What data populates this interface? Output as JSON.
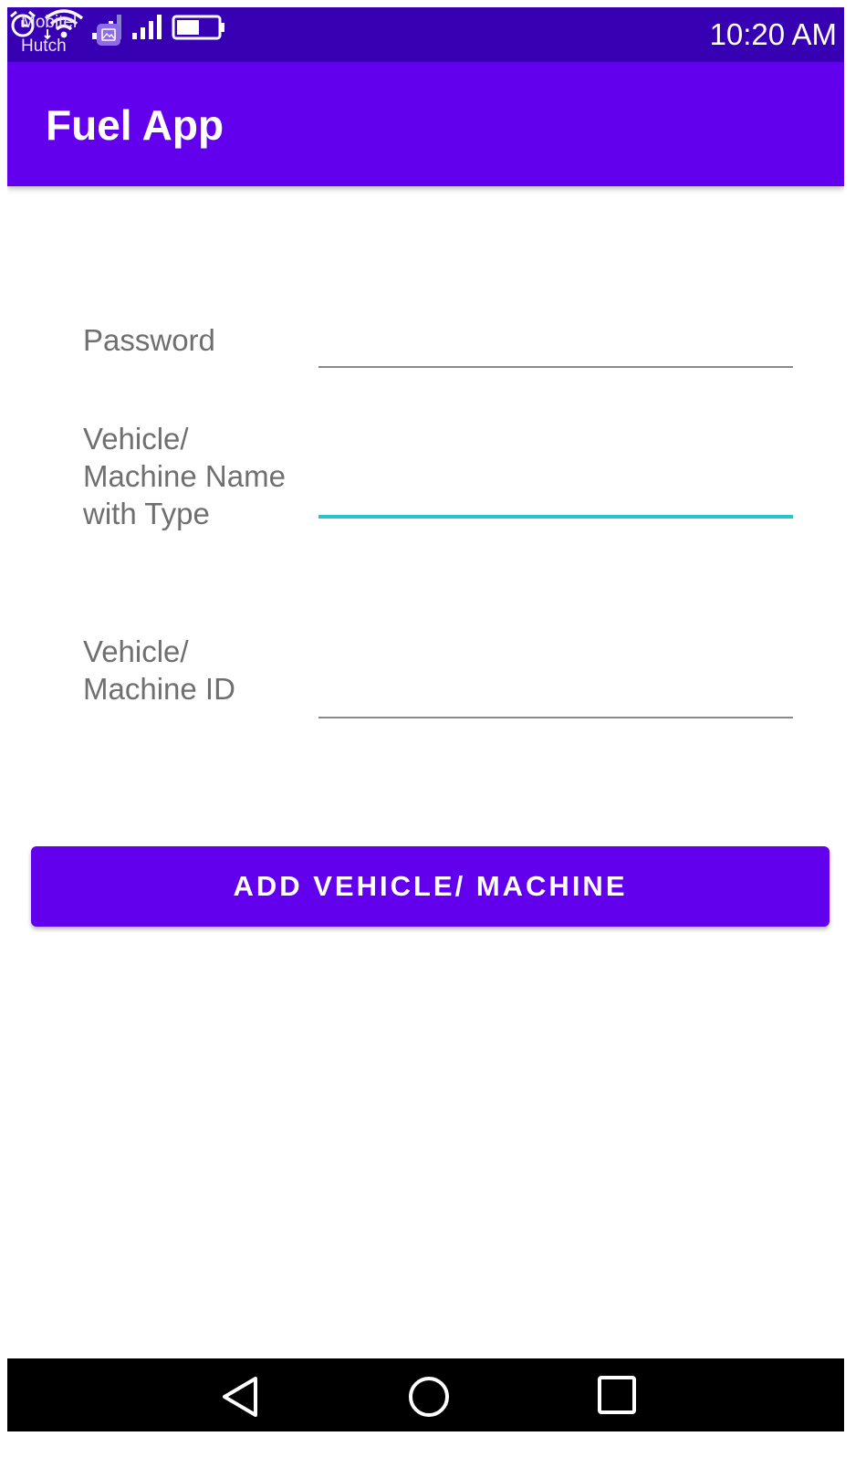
{
  "status_bar": {
    "carrier_line1": "Mobitel",
    "carrier_line2": "Hutch",
    "time": "10:20 AM",
    "icons": [
      "gallery-icon",
      "alarm-icon",
      "wifi-icon",
      "signal-icon",
      "signal-icon",
      "battery-icon"
    ]
  },
  "app_bar": {
    "title": "Fuel App"
  },
  "form": {
    "password_label": "Password",
    "vehicle_name_label": "Vehicle/\nMachine Name\nwith Type",
    "vehicle_id_label": "Vehicle/\nMachine ID"
  },
  "add_button": {
    "label": "ADD VEHICLE/ MACHINE"
  },
  "nav_bar": {
    "icons": [
      "back-icon",
      "home-icon",
      "recents-icon"
    ]
  },
  "colors": {
    "status_bar": "#3700b3",
    "primary": "#6200ee",
    "focus_underline": "#26c6c6",
    "label_text": "#6f6f6f"
  }
}
